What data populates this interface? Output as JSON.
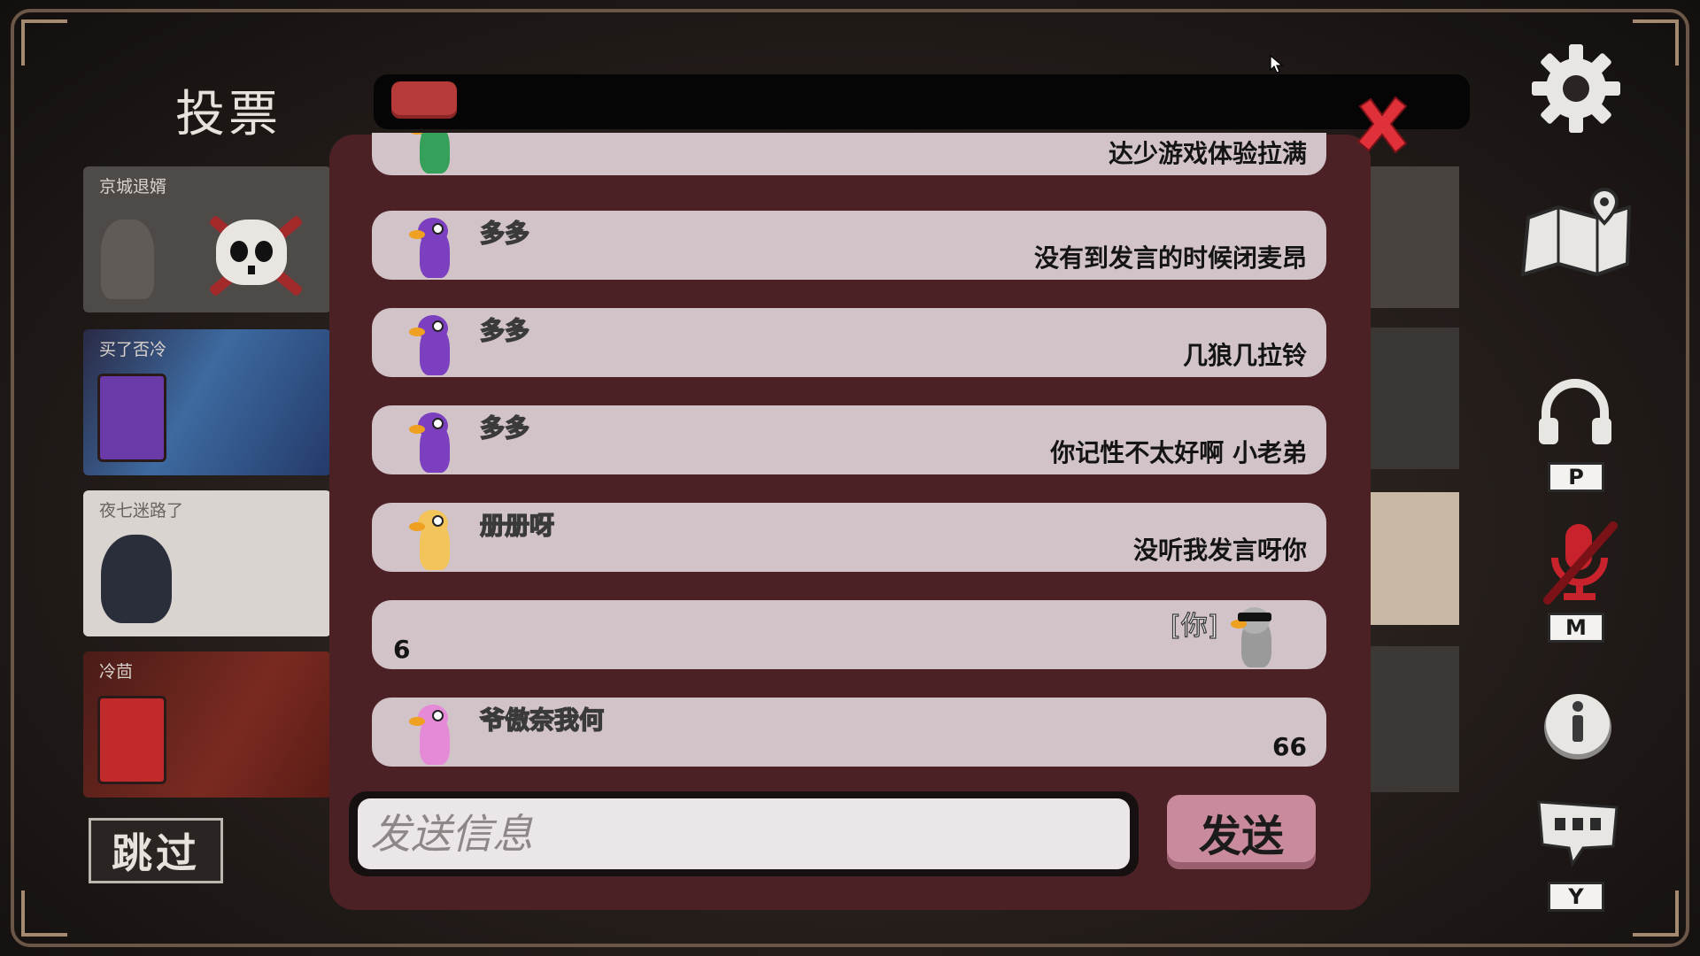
{
  "screen": {
    "title": "投票"
  },
  "players": [
    {
      "name": "京城退婿",
      "status": "dead"
    },
    {
      "name": "买了否冷",
      "status": "alive"
    },
    {
      "name": "夜七迷路了",
      "status": "alive"
    },
    {
      "name": "冷茴",
      "status": "alive"
    }
  ],
  "skip_button": {
    "label": "跳过"
  },
  "chat": {
    "messages": [
      {
        "sender": "",
        "text": "达少游戏体验拉满",
        "avatar_color": "#34a05a"
      },
      {
        "sender": "多多",
        "text": "没有到发言的时候闭麦昂",
        "avatar_color": "#7b3fbf"
      },
      {
        "sender": "多多",
        "text": "几狼几拉铃",
        "avatar_color": "#7b3fbf"
      },
      {
        "sender": "多多",
        "text": "你记性不太好啊 小老弟",
        "avatar_color": "#7b3fbf"
      },
      {
        "sender": "册册呀",
        "text": "没听我发言呀你",
        "avatar_color": "#f2c45a"
      },
      {
        "sender": "",
        "text": "6",
        "is_self": true,
        "self_tag": "[你]",
        "avatar_color": "#9a9a9a"
      },
      {
        "sender": "爷傲奈我何",
        "text": "66",
        "avatar_color": "#e48ad6"
      }
    ],
    "input_placeholder": "发送信息",
    "send_label": "发送"
  },
  "side_controls": {
    "voice_key": "P",
    "mute_key": "M",
    "chat_key": "Y"
  },
  "colors": {
    "modal_bg": "#4b2126",
    "message_bg": "#d2c3c8",
    "send_button": "#c98a9b",
    "close_x": "#e0303a",
    "timer_fill": "#b73a3a"
  }
}
